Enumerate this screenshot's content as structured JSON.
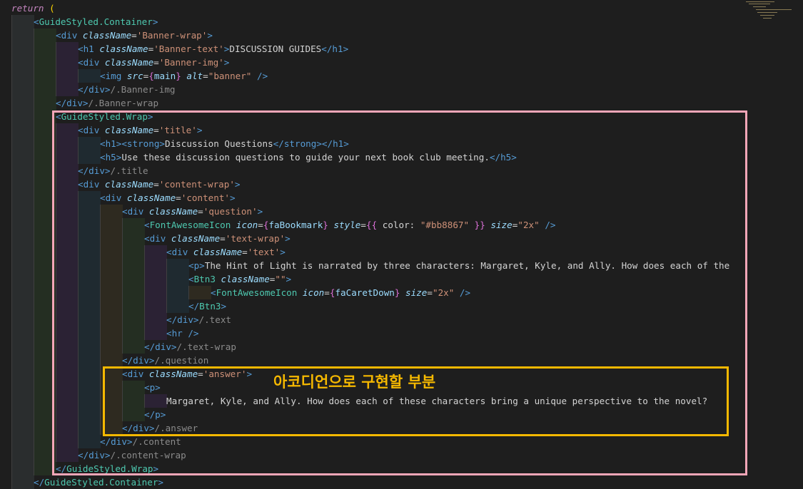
{
  "annotation": {
    "label": "아코디언으로 구현할 부분",
    "color": "#f5b800"
  },
  "highlight_colors": {
    "pink": "#f4a6b8",
    "yellow": "#f5b800"
  },
  "code_lines": [
    {
      "indent": 0,
      "tokens": [
        [
          "kw",
          "return"
        ],
        [
          "tx",
          " "
        ],
        [
          "p",
          "("
        ]
      ]
    },
    {
      "indent": 1,
      "tokens": [
        [
          "tg",
          "<"
        ],
        [
          "cp",
          "GuideStyled.Container"
        ],
        [
          "tg",
          ">"
        ]
      ]
    },
    {
      "indent": 2,
      "tokens": [
        [
          "tg",
          "<div "
        ],
        [
          "at",
          "className"
        ],
        [
          "tx",
          "="
        ],
        [
          "sv",
          "'Banner-wrap'"
        ],
        [
          "tg",
          ">"
        ]
      ]
    },
    {
      "indent": 3,
      "tokens": [
        [
          "tg",
          "<h1 "
        ],
        [
          "at",
          "className"
        ],
        [
          "tx",
          "="
        ],
        [
          "sv",
          "'Banner-text'"
        ],
        [
          "tg",
          ">"
        ],
        [
          "tx",
          "DISCUSSION GUIDES"
        ],
        [
          "tg",
          "</h1>"
        ]
      ]
    },
    {
      "indent": 3,
      "tokens": [
        [
          "tg",
          "<div "
        ],
        [
          "at",
          "className"
        ],
        [
          "tx",
          "="
        ],
        [
          "sv",
          "'Banner-img'"
        ],
        [
          "tg",
          ">"
        ]
      ]
    },
    {
      "indent": 4,
      "tokens": [
        [
          "tg",
          "<img "
        ],
        [
          "at",
          "src"
        ],
        [
          "tx",
          "="
        ],
        [
          "br",
          "{"
        ],
        [
          "id",
          "main"
        ],
        [
          "br",
          "}"
        ],
        [
          "tx",
          " "
        ],
        [
          "at",
          "alt"
        ],
        [
          "tx",
          "="
        ],
        [
          "sv",
          "\"banner\""
        ],
        [
          "tx",
          " "
        ],
        [
          "tg",
          "/>"
        ]
      ]
    },
    {
      "indent": 3,
      "tokens": [
        [
          "tg",
          "</div>"
        ],
        [
          "cm",
          "/.Banner-img"
        ]
      ]
    },
    {
      "indent": 2,
      "tokens": [
        [
          "tg",
          "</div>"
        ],
        [
          "cm",
          "/.Banner-wrap"
        ]
      ]
    },
    {
      "indent": 2,
      "tokens": [
        [
          "tg",
          "<"
        ],
        [
          "cp",
          "GuideStyled.Wrap"
        ],
        [
          "tg",
          ">"
        ]
      ]
    },
    {
      "indent": 3,
      "tokens": [
        [
          "tg",
          "<div "
        ],
        [
          "at",
          "className"
        ],
        [
          "tx",
          "="
        ],
        [
          "sv",
          "'title'"
        ],
        [
          "tg",
          ">"
        ]
      ]
    },
    {
      "indent": 4,
      "tokens": [
        [
          "tg",
          "<h1>"
        ],
        [
          "tg",
          "<strong>"
        ],
        [
          "tx",
          "Discussion Questions"
        ],
        [
          "tg",
          "</strong>"
        ],
        [
          "tg",
          "</h1>"
        ]
      ]
    },
    {
      "indent": 4,
      "tokens": [
        [
          "tg",
          "<h5>"
        ],
        [
          "tx",
          "Use these discussion questions to guide your next book club meeting."
        ],
        [
          "tg",
          "</h5>"
        ]
      ]
    },
    {
      "indent": 3,
      "tokens": [
        [
          "tg",
          "</div>"
        ],
        [
          "cm",
          "/.title"
        ]
      ]
    },
    {
      "indent": 3,
      "tokens": [
        [
          "tg",
          "<div "
        ],
        [
          "at",
          "className"
        ],
        [
          "tx",
          "="
        ],
        [
          "sv",
          "'content-wrap'"
        ],
        [
          "tg",
          ">"
        ]
      ]
    },
    {
      "indent": 4,
      "tokens": [
        [
          "tg",
          "<div "
        ],
        [
          "at",
          "className"
        ],
        [
          "tx",
          "="
        ],
        [
          "sv",
          "'content'"
        ],
        [
          "tg",
          ">"
        ]
      ]
    },
    {
      "indent": 5,
      "tokens": [
        [
          "tg",
          "<div "
        ],
        [
          "at",
          "className"
        ],
        [
          "tx",
          "="
        ],
        [
          "sv",
          "'question'"
        ],
        [
          "tg",
          ">"
        ]
      ]
    },
    {
      "indent": 6,
      "tokens": [
        [
          "tg",
          "<"
        ],
        [
          "cp",
          "FontAwesomeIcon"
        ],
        [
          "tx",
          " "
        ],
        [
          "at",
          "icon"
        ],
        [
          "tx",
          "="
        ],
        [
          "br",
          "{"
        ],
        [
          "id",
          "faBookmark"
        ],
        [
          "br",
          "}"
        ],
        [
          "tx",
          " "
        ],
        [
          "at",
          "style"
        ],
        [
          "tx",
          "="
        ],
        [
          "br",
          "{{"
        ],
        [
          "tx",
          " color: "
        ],
        [
          "sv",
          "\"#bb8867\""
        ],
        [
          "tx",
          " "
        ],
        [
          "br",
          "}}"
        ],
        [
          "tx",
          " "
        ],
        [
          "at",
          "size"
        ],
        [
          "tx",
          "="
        ],
        [
          "sv",
          "\"2x\""
        ],
        [
          "tx",
          " "
        ],
        [
          "tg",
          "/>"
        ]
      ]
    },
    {
      "indent": 6,
      "tokens": [
        [
          "tg",
          "<div "
        ],
        [
          "at",
          "className"
        ],
        [
          "tx",
          "="
        ],
        [
          "sv",
          "'text-wrap'"
        ],
        [
          "tg",
          ">"
        ]
      ]
    },
    {
      "indent": 7,
      "tokens": [
        [
          "tg",
          "<div "
        ],
        [
          "at",
          "className"
        ],
        [
          "tx",
          "="
        ],
        [
          "sv",
          "'text'"
        ],
        [
          "tg",
          ">"
        ]
      ]
    },
    {
      "indent": 8,
      "tokens": [
        [
          "tg",
          "<p>"
        ],
        [
          "tx",
          "The Hint of Light is narrated by three characters: Margaret, Kyle, and Ally. How does each of the"
        ]
      ]
    },
    {
      "indent": 8,
      "tokens": [
        [
          "tg",
          "<"
        ],
        [
          "cp",
          "Btn3"
        ],
        [
          "tx",
          " "
        ],
        [
          "at",
          "className"
        ],
        [
          "tx",
          "="
        ],
        [
          "sv",
          "\"\""
        ],
        [
          "tg",
          ">"
        ]
      ]
    },
    {
      "indent": 9,
      "tokens": [
        [
          "tg",
          "<"
        ],
        [
          "cp",
          "FontAwesomeIcon"
        ],
        [
          "tx",
          " "
        ],
        [
          "at",
          "icon"
        ],
        [
          "tx",
          "="
        ],
        [
          "br",
          "{"
        ],
        [
          "id",
          "faCaretDown"
        ],
        [
          "br",
          "}"
        ],
        [
          "tx",
          " "
        ],
        [
          "at",
          "size"
        ],
        [
          "tx",
          "="
        ],
        [
          "sv",
          "\"2x\""
        ],
        [
          "tx",
          " "
        ],
        [
          "tg",
          "/>"
        ]
      ]
    },
    {
      "indent": 8,
      "tokens": [
        [
          "tg",
          "</"
        ],
        [
          "cp",
          "Btn3"
        ],
        [
          "tg",
          ">"
        ]
      ]
    },
    {
      "indent": 7,
      "tokens": [
        [
          "tg",
          "</div>"
        ],
        [
          "cm",
          "/.text"
        ]
      ]
    },
    {
      "indent": 7,
      "tokens": [
        [
          "tg",
          "<hr />"
        ]
      ]
    },
    {
      "indent": 6,
      "tokens": [
        [
          "tg",
          "</div>"
        ],
        [
          "cm",
          "/.text-wrap"
        ]
      ]
    },
    {
      "indent": 5,
      "tokens": [
        [
          "tg",
          "</div>"
        ],
        [
          "cm",
          "/.question"
        ]
      ]
    },
    {
      "indent": 5,
      "tokens": [
        [
          "tg",
          "<div "
        ],
        [
          "at",
          "className"
        ],
        [
          "tx",
          "="
        ],
        [
          "sv",
          "'answer'"
        ],
        [
          "tg",
          ">"
        ]
      ]
    },
    {
      "indent": 6,
      "tokens": [
        [
          "tg",
          "<p>"
        ]
      ]
    },
    {
      "indent": 7,
      "tokens": [
        [
          "tx",
          "Margaret, Kyle, and Ally. How does each of these characters bring a unique perspective to the novel?"
        ]
      ]
    },
    {
      "indent": 6,
      "tokens": [
        [
          "tg",
          "</p>"
        ]
      ]
    },
    {
      "indent": 5,
      "tokens": [
        [
          "tg",
          "</div>"
        ],
        [
          "cm",
          "/.answer"
        ]
      ]
    },
    {
      "indent": 4,
      "tokens": [
        [
          "tg",
          "</div>"
        ],
        [
          "cm",
          "/.content"
        ]
      ]
    },
    {
      "indent": 3,
      "tokens": [
        [
          "tg",
          "</div>"
        ],
        [
          "cm",
          "/.content-wrap"
        ]
      ]
    },
    {
      "indent": 2,
      "tokens": [
        [
          "tg",
          "</"
        ],
        [
          "cp",
          "GuideStyled.Wrap"
        ],
        [
          "tg",
          ">"
        ]
      ]
    },
    {
      "indent": 1,
      "tokens": [
        [
          "tg",
          "</"
        ],
        [
          "cp",
          "GuideStyled.Container"
        ],
        [
          "tg",
          ">"
        ]
      ]
    }
  ]
}
